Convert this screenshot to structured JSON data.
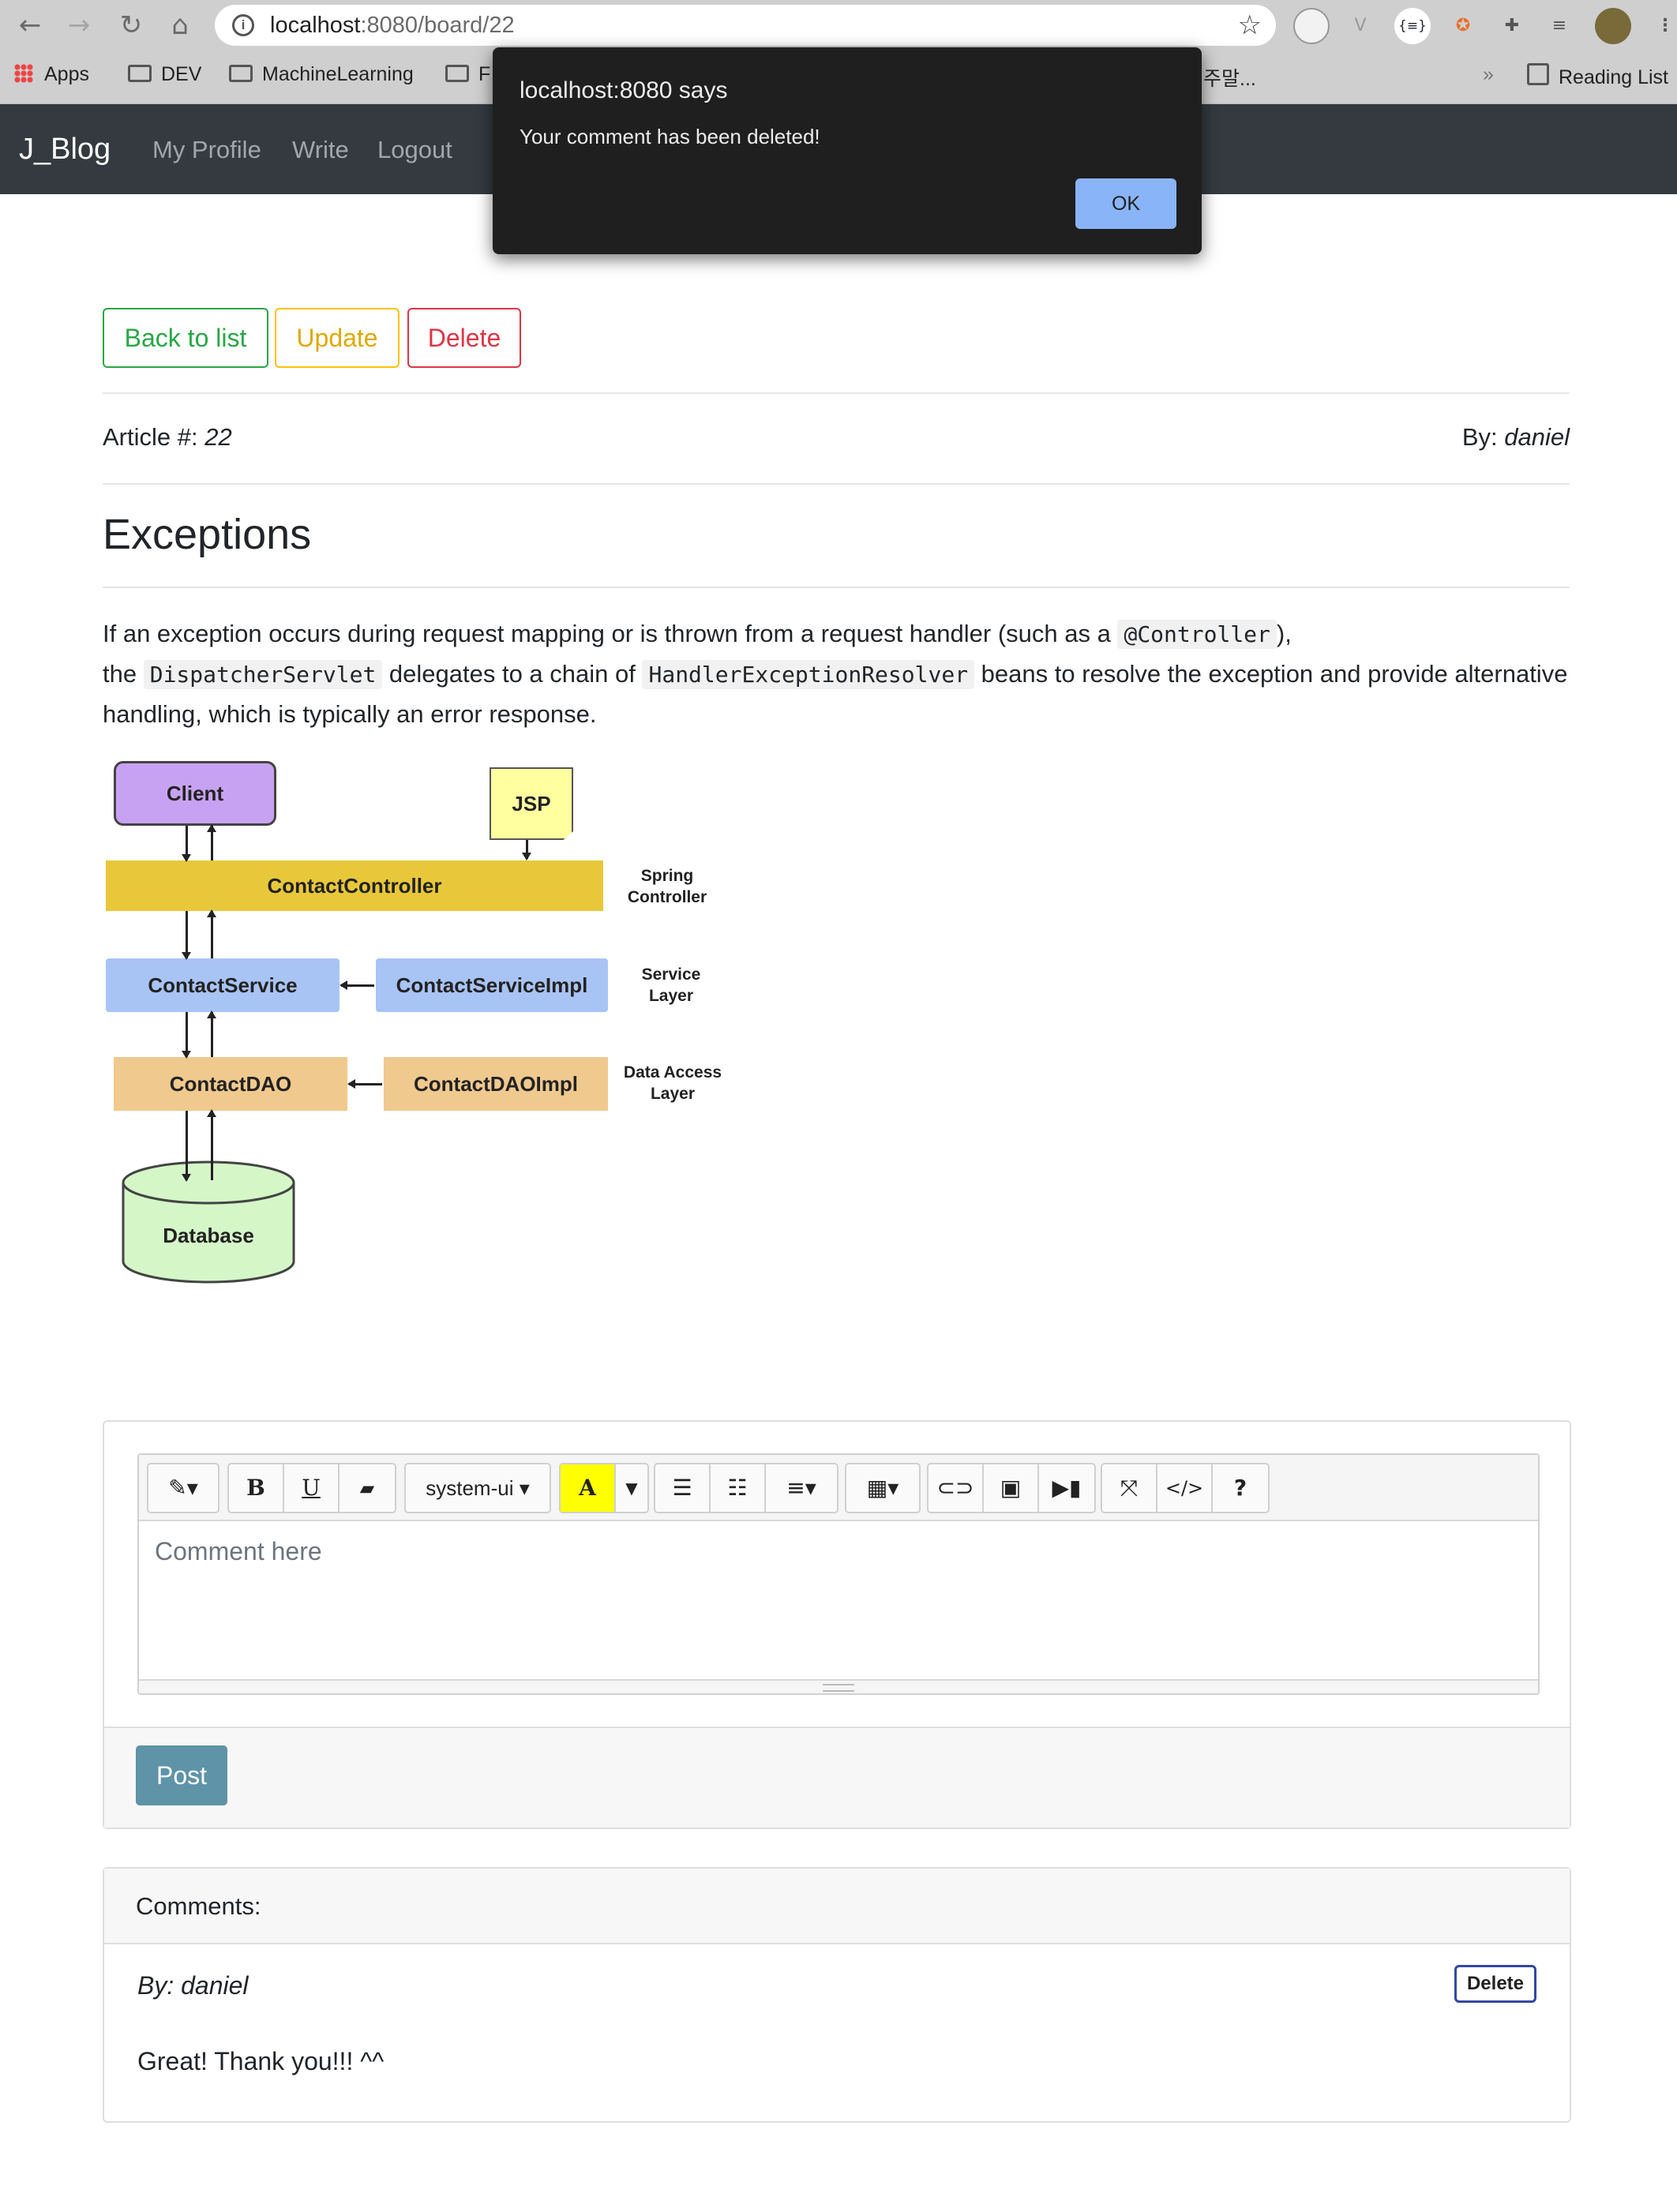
{
  "browser": {
    "url_host": "localhost",
    "url_path": ":8080/board/22",
    "bookmarks": [
      "Apps",
      "DEV",
      "MachineLearning",
      "F",
      "주말...",
      "»",
      "Reading List"
    ]
  },
  "navbar": {
    "brand": "J_Blog",
    "links": [
      "My Profile",
      "Write",
      "Logout"
    ]
  },
  "dialog": {
    "title": "localhost:8080 says",
    "message": "Your comment has been deleted!",
    "ok_label": "OK"
  },
  "actions": {
    "back_label": "Back to list",
    "update_label": "Update",
    "delete_label": "Delete",
    "colors": {
      "back": "#28a745",
      "update": "#ffc107",
      "delete": "#dc3545"
    }
  },
  "article": {
    "number_label": "Article #:",
    "number": "22",
    "author_label": "By:",
    "author": "daniel",
    "title": "Exceptions",
    "paragraph": {
      "t1": "If an exception occurs during request mapping or is thrown from a request handler (such as a ",
      "c1": "@Controller",
      "t2": "),",
      "t3": "the ",
      "c2": "DispatcherServlet",
      "t4": " delegates to a chain of ",
      "c3": "HandlerExceptionResolver",
      "t5": " beans to resolve the exception and provide alternative handling, which is typically an error response."
    }
  },
  "diagram": {
    "client": "Client",
    "jsp": "JSP",
    "controller": "ContactController",
    "controller_layer": [
      "Spring",
      "Controller"
    ],
    "service": "ContactService",
    "service_impl": "ContactServiceImpl",
    "service_layer": [
      "Service",
      "Layer"
    ],
    "dao": "ContactDAO",
    "dao_impl": "ContactDAOImpl",
    "dao_layer": [
      "Data Access",
      "Layer"
    ],
    "database": "Database"
  },
  "editor": {
    "font_select": "system-ui",
    "placeholder": "Comment here",
    "post_label": "Post"
  },
  "comments": {
    "header": "Comments:",
    "items": [
      {
        "by": "By: daniel",
        "text": "Great! Thank you!!! ^^",
        "delete_label": "Delete"
      }
    ]
  }
}
